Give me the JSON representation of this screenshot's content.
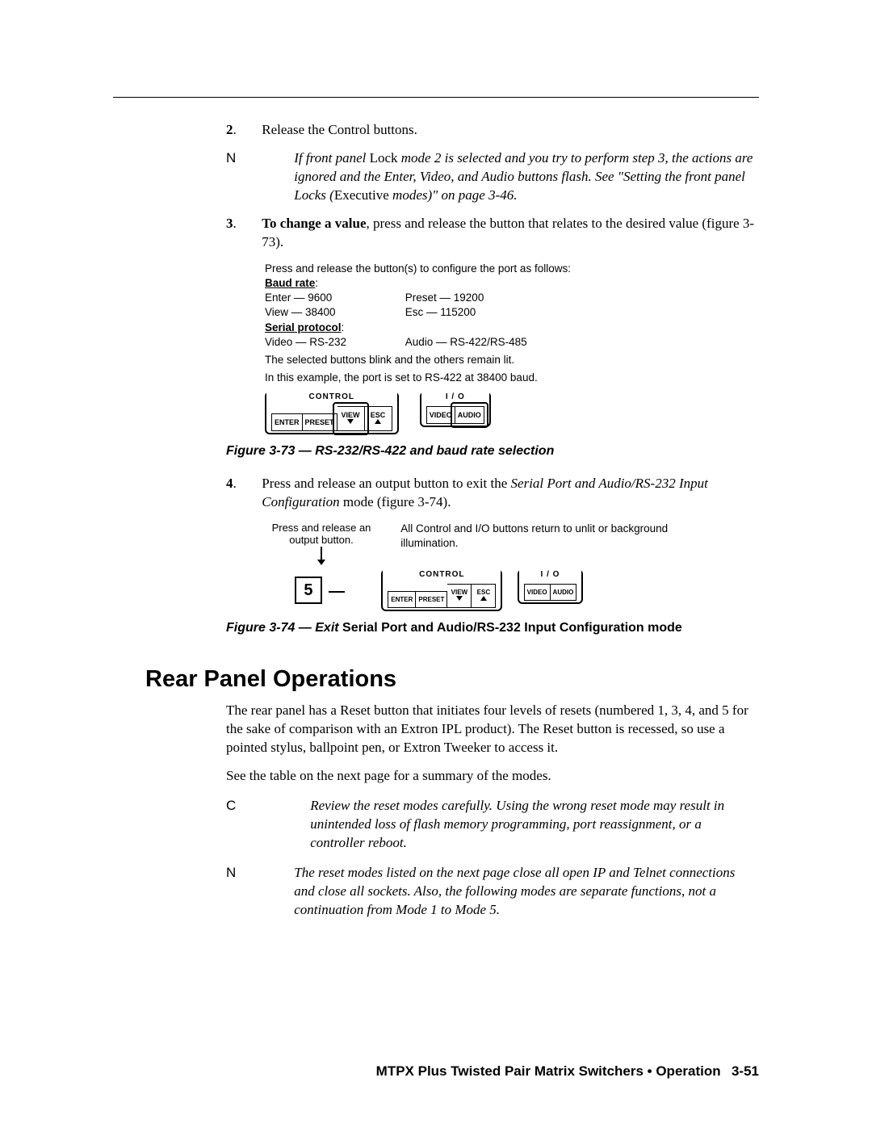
{
  "step2": {
    "num": "2",
    "text": "Release the Control buttons."
  },
  "note1": {
    "prefix": "N",
    "t1": "If front panel ",
    "lock": "Lock",
    "t2": " mode 2 is selected and you try to perform step 3, the actions are ignored and the Enter, Video, and Audio buttons flash.  See \"Setting the front panel Locks (",
    "exec": "Executive",
    "t3": " modes)\" on page 3-46."
  },
  "step3": {
    "num": "3",
    "bold": "To change a value",
    "rest": ", press and release the button that relates to the desired value (figure 3-73)."
  },
  "fig73data": {
    "intro": "Press and release the button(s) to configure the port as follows:",
    "baud_label": "Baud rate",
    "baud": {
      "enter": "Enter — 9600",
      "preset": "Preset — 19200",
      "view": "View — 38400",
      "esc": "Esc — 115200"
    },
    "sp_label": "Serial protocol",
    "sp": {
      "video": "Video — RS-232",
      "audio": "Audio — RS-422/RS-485"
    },
    "sel": "The selected buttons blink and the others remain lit.",
    "ex": "In this example, the port is set to RS-422 at 38400 baud."
  },
  "panel1": {
    "control": "CONTROL",
    "io": "I / O",
    "enter": "ENTER",
    "preset": "PRESET",
    "view": "VIEW",
    "esc": "ESC",
    "video": "VIDEO",
    "audio": "AUDIO"
  },
  "fig73cap": "Figure 3-73 — RS-232/RS-422 and baud rate selection",
  "step4": {
    "num": "4",
    "t1": "Press and release an output button to exit the ",
    "ital": "Serial Port and Audio/RS-232 Input Configuration",
    "t2": " mode (figure 3-74)."
  },
  "fig74": {
    "press": "Press and release an output button.",
    "note": "All Control and I/O buttons return to unlit or background illumination.",
    "btn5": "5"
  },
  "fig74cap_pre": "Figure 3-74 — Exit ",
  "fig74cap_bold": "Serial Port and Audio/RS-232 Input Configuration mode",
  "h2": "Rear Panel Operations",
  "rear_p1": "The rear panel has a Reset button that initiates four levels of resets (numbered 1, 3, 4, and 5 for the sake of comparison with an Extron IPL product).  The Reset button is recessed, so use a pointed stylus, ballpoint pen, or Extron Tweeker to access it.",
  "rear_p2": "See the table on the next page for a summary of the modes.",
  "caution": {
    "c": "C",
    "text": "Review the reset modes carefully.  Using the wrong reset mode may result in unintended loss of flash memory programming, port reassignment, or a controller reboot."
  },
  "note2": {
    "n": "N",
    "text": "The reset modes listed on the next page close all open IP and Telnet connections and close all sockets.  Also, the following modes are separate functions, not a continuation from Mode 1 to Mode 5."
  },
  "footer": {
    "t": "MTPX Plus Twisted Pair Matrix Switchers • Operation",
    "page": "3-51"
  }
}
